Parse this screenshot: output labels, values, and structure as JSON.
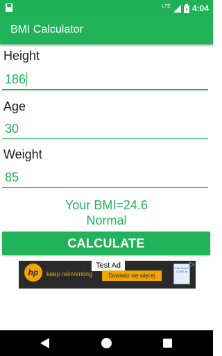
{
  "status_bar": {
    "time": "4:04",
    "network_label": "LTE",
    "icons": [
      "save-icon",
      "lte-signal-icon",
      "battery-icon"
    ]
  },
  "app_bar": {
    "title": "BMI Calculator"
  },
  "form": {
    "height": {
      "label": "Height",
      "value": "186"
    },
    "age": {
      "label": "Age",
      "value": "30"
    },
    "weight": {
      "label": "Weight",
      "value": "85"
    }
  },
  "result": {
    "bmi_text": "Your BMI=24.6",
    "category": "Normal"
  },
  "calculate_button": {
    "label": "CALCULATE"
  },
  "ad": {
    "badge": "Test Ad",
    "brand": "hp",
    "tagline": "keep reinventing",
    "cta": "Dowiedz się więcej",
    "intel_text": "intel inside CORE i5"
  },
  "colors": {
    "accent": "#22b35a",
    "status_bar": "#1fb155",
    "ad_accent": "#f0a500"
  },
  "nav_bar": {
    "icons": [
      "back-icon",
      "home-icon",
      "recents-icon"
    ]
  }
}
